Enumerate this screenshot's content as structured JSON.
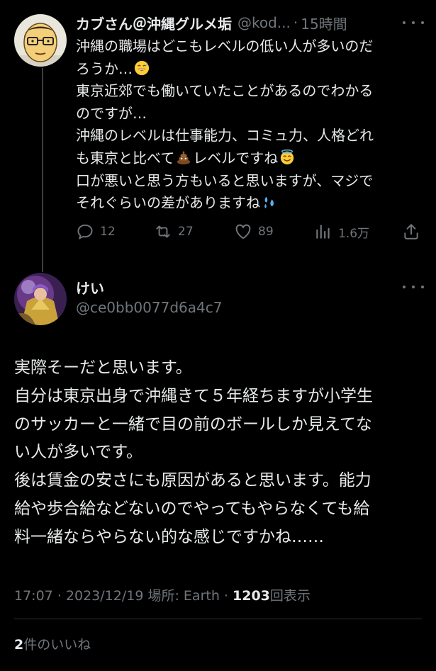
{
  "tweet": {
    "author_name": "カブさん＠沖縄グルメ垢",
    "handle": "@kod...",
    "time_sep": "·",
    "time": "15時間",
    "lines": [
      "沖縄の職場はどこもレベルの低い人が多いのだ",
      "ろうか…",
      "東京近郊でも働いていたことがあるのでわかる",
      "のですが…",
      "沖縄のレベルは仕事能力、コミュ力、人格どれ",
      "も東京と比べて",
      "レベルですね",
      "口が悪いと思う方もいると思いますが、マジで",
      "それぐらいの差がありますね"
    ],
    "emojis": [
      "grinning-sweat-emoji",
      "poop-emoji",
      "halo-emoji",
      "sweat-droplets-emoji"
    ],
    "stats": {
      "replies": "12",
      "retweets": "27",
      "likes": "89",
      "views": "1.6万"
    }
  },
  "reply": {
    "author_name": "けい",
    "handle": "@ce0bb0077d6a4c7",
    "lines": [
      "実際そーだと思います。",
      "自分は東京出身で沖縄きて５年経ちますが小学生",
      "のサッカーと一緒で目の前のボールしか見えてな",
      "い人が多いです。",
      "後は賃金の安さにも原因があると思います。能力",
      "給や歩合給などないのでやってもやらなくても給",
      "料一緒ならやらない的な感じですかね……"
    ],
    "meta": {
      "time": "17:07",
      "sep1": "·",
      "date": "2023/12/19",
      "location_label": "場所:",
      "location": "Earth",
      "sep2": "·",
      "views_count": "1203",
      "views_label": "回表示"
    },
    "likes": {
      "count": "2",
      "label": "件のいいね"
    }
  },
  "colors": {
    "background": "#000000",
    "text": "#e7e9ea",
    "secondary": "#71767b",
    "divider": "#2f3336"
  }
}
